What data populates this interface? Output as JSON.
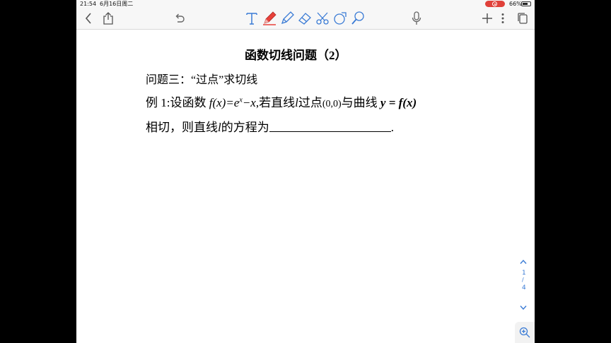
{
  "status_bar": {
    "time": "21:54",
    "date": "6月16日周二",
    "battery_percent": "66%",
    "battery_level": 0.66,
    "recording_color": "#e0413a"
  },
  "toolbar": {
    "left": [
      "back-icon",
      "share-icon",
      "undo-icon"
    ],
    "tools": [
      "text-tool-icon",
      "pen-icon",
      "highlighter-icon",
      "eraser-icon",
      "scissors-icon",
      "shape-icon",
      "lasso-icon",
      "microphone-icon"
    ],
    "right": [
      "add-page-icon",
      "more-icon",
      "pages-icon"
    ],
    "accent_color": "#3a7bd5",
    "pen_color": "#e8413a"
  },
  "document": {
    "title": "函数切线问题（2）",
    "subtitle": "问题三：“过点”求切线",
    "example_label": "例 1:",
    "example_text_1": "设函数",
    "function_name": "f",
    "function_arg": "(x)=e",
    "exponent": "x",
    "function_tail": "−x",
    "example_text_2": ",若直线",
    "line_var": "l",
    "example_text_3": "过点",
    "point": "(0,0)",
    "example_text_4": "与曲线",
    "curve": "y = f(x)",
    "line2_text_1": "相切，则直线",
    "line2_var": "l",
    "line2_text_2": "的方程为",
    "line2_end": "."
  },
  "page_nav": {
    "current": "1",
    "separator": "/",
    "total": "4"
  }
}
